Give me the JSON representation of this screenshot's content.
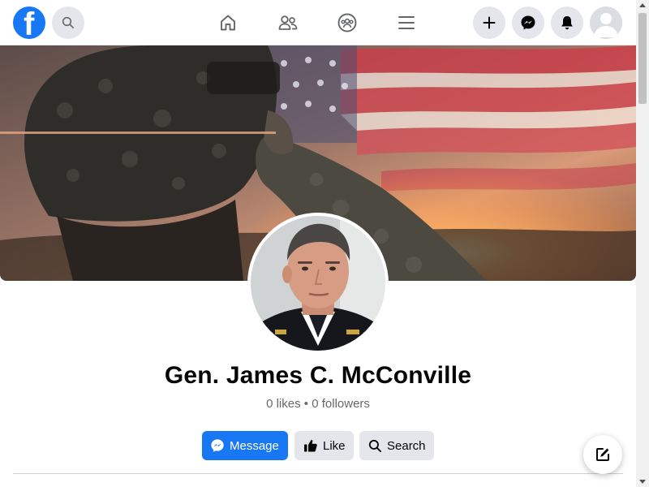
{
  "header": {
    "logo_letter": "f",
    "icons": [
      "facebook-logo",
      "search-icon",
      "home-icon",
      "friends-icon",
      "groups-icon",
      "menu-icon",
      "plus-icon",
      "messenger-icon",
      "bell-icon",
      "avatar"
    ]
  },
  "profile": {
    "name": "Gen. James C. McConville",
    "likes": "0 likes",
    "separator": "•",
    "followers": "0 followers"
  },
  "actions": {
    "message_label": "Message",
    "like_label": "Like",
    "search_label": "Search"
  },
  "colors": {
    "brand_blue": "#1877f2",
    "button_gray": "#e4e6eb",
    "secondary_text": "#65676b"
  }
}
